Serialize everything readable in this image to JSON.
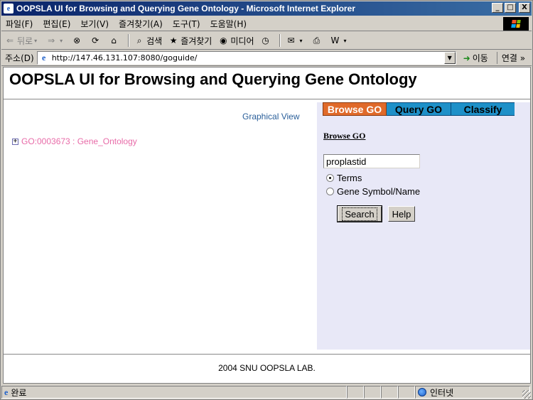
{
  "window": {
    "title": "OOPSLA UI for Browsing and Querying Gene Ontology - Microsoft Internet Explorer",
    "minimize": "_",
    "maximize": "□",
    "close": "X"
  },
  "menubar": {
    "items": [
      "파일(F)",
      "편집(E)",
      "보기(V)",
      "즐겨찾기(A)",
      "도구(T)",
      "도움말(H)"
    ]
  },
  "toolbar": {
    "back": "뒤로",
    "search": "검색",
    "favorites": "즐겨찾기",
    "media": "미디어"
  },
  "addressbar": {
    "label": "주소(D)",
    "url": "http://147.46.131.107:8080/goguide/",
    "go": "이동",
    "links": "연결 »"
  },
  "page": {
    "title": "OOPSLA UI for Browsing and Querying Gene Ontology",
    "graphical_view": "Graphical View",
    "tree_node": "GO:0003673 : Gene_Ontology",
    "tabs": [
      "Browse GO",
      "Query GO",
      "Classify"
    ],
    "section_heading": "Browse GO",
    "search_value": "proplastid",
    "radio_terms": "Terms",
    "radio_gene": "Gene Symbol/Name",
    "search_button": "Search",
    "help_button": "Help",
    "footer": "2004 SNU OOPSLA LAB."
  },
  "statusbar": {
    "status": "완료",
    "zone": "인터넷"
  }
}
